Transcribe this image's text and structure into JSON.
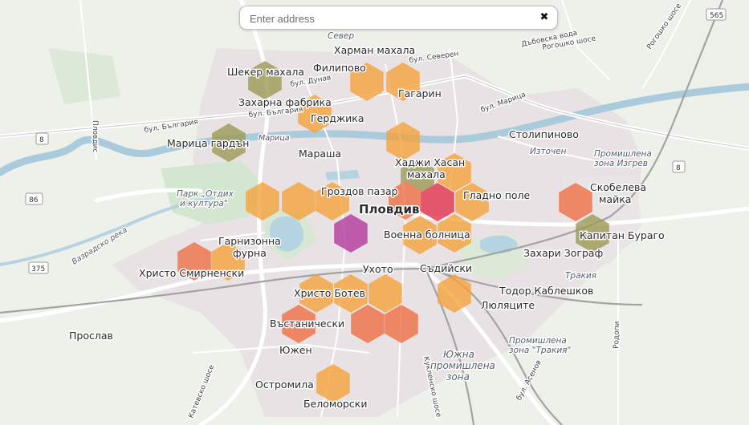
{
  "search": {
    "placeholder": "Enter address",
    "clear_glyph": "✖"
  },
  "colors": {
    "land": "#eef0ea",
    "urban": "#e7dfe1",
    "water": "#a9cbdc",
    "park": "#cfe3cc",
    "rail": "#9a9a9a",
    "hex_orange": "#f5a33c",
    "hex_red_orange": "#ef7046",
    "hex_red": "#e3344f",
    "hex_olive": "#9c9a55",
    "hex_purple": "#b53a9e"
  },
  "places": [
    {
      "id": "plovdiv",
      "text": "Пловдив"
    },
    {
      "id": "harman",
      "text": "Харман махала"
    },
    {
      "id": "sever",
      "text": "Север"
    },
    {
      "id": "filipovo",
      "text": "Филипово"
    },
    {
      "id": "sheker",
      "text": "Шекер махала"
    },
    {
      "id": "gagarin",
      "text": "Гагарин"
    },
    {
      "id": "zaharna",
      "text": "Захарна фабрика"
    },
    {
      "id": "gerdzhika",
      "text": "Герджика"
    },
    {
      "id": "marica_gardan",
      "text": "Марица гардън"
    },
    {
      "id": "marasha",
      "text": "Мараша"
    },
    {
      "id": "stolipinovo",
      "text": "Столипиново"
    },
    {
      "id": "hadzhi1",
      "text": "Хаджи Хасан"
    },
    {
      "id": "hadzhi2",
      "text": "махала"
    },
    {
      "id": "groz",
      "text": "Гроздов пазар"
    },
    {
      "id": "gladno",
      "text": "Гладно поле"
    },
    {
      "id": "skob1",
      "text": "Скобелева"
    },
    {
      "id": "skob2",
      "text": "майка"
    },
    {
      "id": "garn1",
      "text": "Гарнизонна"
    },
    {
      "id": "garn2",
      "text": "фурна"
    },
    {
      "id": "voenna",
      "text": "Военна болница"
    },
    {
      "id": "kapitan",
      "text": "Капитан Бураго"
    },
    {
      "id": "zahari",
      "text": "Захари Зограф"
    },
    {
      "id": "hristos",
      "text": "Христо Смирненски"
    },
    {
      "id": "uhoto",
      "text": "Ухото"
    },
    {
      "id": "sadiyski",
      "text": "Съдийски"
    },
    {
      "id": "hristob",
      "text": "Христо Ботев"
    },
    {
      "id": "todor",
      "text": "Тодор Каблешков"
    },
    {
      "id": "lyulyacite",
      "text": "Люляците"
    },
    {
      "id": "prosla",
      "text": "Прослав"
    },
    {
      "id": "vastan",
      "text": "Въстанически"
    },
    {
      "id": "yuzhen",
      "text": "Южен"
    },
    {
      "id": "ostromila",
      "text": "Остромила"
    },
    {
      "id": "belomorski",
      "text": "Беломорски"
    }
  ],
  "areas": [
    {
      "id": "park",
      "text": [
        "Парк „Отдих",
        "и култура\""
      ]
    },
    {
      "id": "iztochen",
      "text": [
        "Източен"
      ]
    },
    {
      "id": "izgrev",
      "text": [
        "Промишлена",
        "зона Изгрев"
      ]
    },
    {
      "id": "trakia_pz",
      "text": [
        "Тракия"
      ]
    },
    {
      "id": "pz_trakia",
      "text": [
        "Промишлена",
        "зона \"Тракия\""
      ]
    },
    {
      "id": "yuzhna",
      "text": [
        "Южна",
        "промишлена",
        "зона"
      ]
    }
  ],
  "roads": [
    {
      "id": "bul_sever",
      "text": "бул. Северен"
    },
    {
      "id": "bul_dunav",
      "text": "бул. Дунав"
    },
    {
      "id": "bul_bulgaria",
      "text": "бул. България"
    },
    {
      "id": "bul_bulgaria2",
      "text": "бул. България"
    },
    {
      "id": "bul_mar",
      "text": "бул. Марица"
    },
    {
      "id": "marica_river",
      "text": "Марица"
    },
    {
      "id": "dabovska",
      "text": "Дъбовска вода"
    },
    {
      "id": "rogoshko",
      "text": "Рогошко шосе"
    },
    {
      "id": "rogoshko2",
      "text": "Рогошко шосе"
    },
    {
      "id": "vazrazhd",
      "text": "Вазрадско река"
    },
    {
      "id": "plovdis",
      "text": "Пловдис"
    },
    {
      "id": "kuklensko",
      "text": "Кукленско шосе"
    },
    {
      "id": "asenov",
      "text": "бул. Асенов"
    },
    {
      "id": "rodopi",
      "text": "Родопи"
    },
    {
      "id": "katevsko",
      "text": "Катевско шосе"
    }
  ],
  "shields": [
    "565",
    "8",
    "8",
    "86",
    "375"
  ],
  "hexes": [
    {
      "lon": 0,
      "lat": 0,
      "level": "olive"
    },
    {
      "lon": 1,
      "lat": 0,
      "level": "orange"
    },
    {
      "lon": 2,
      "lat": 0,
      "level": "orange"
    },
    {
      "lon": 3,
      "lat": 0,
      "level": "orange"
    }
  ]
}
